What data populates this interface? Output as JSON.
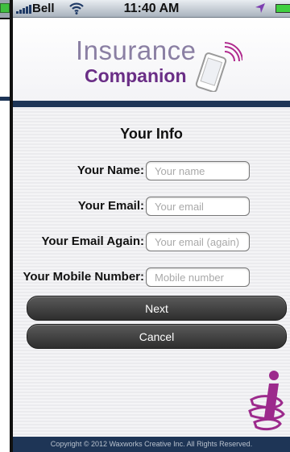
{
  "status_bar": {
    "carrier": "Bell",
    "time": "11:40 AM"
  },
  "app": {
    "logo_line1": "Insurance",
    "logo_line2": "Companion",
    "brand_colors": {
      "navy": "#1e3556",
      "purple": "#6a2e86",
      "accent": "#9c2a8c"
    }
  },
  "form": {
    "title": "Your Info",
    "fields": [
      {
        "label": "Your Name:",
        "placeholder": "Your name",
        "value": ""
      },
      {
        "label": "Your Email:",
        "placeholder": "Your email",
        "value": ""
      },
      {
        "label": "Your Email Again:",
        "placeholder": "Your email (again)",
        "value": ""
      },
      {
        "label": "Your Mobile Number:",
        "placeholder": "Mobile number",
        "value": ""
      }
    ],
    "next_label": "Next",
    "cancel_label": "Cancel"
  },
  "footer": {
    "copyright": "Copyright © 2012 Waxworks Creative Inc. All Rights Reserved."
  },
  "icons": [
    "signal-icon",
    "wifi-icon",
    "location-arrow-icon",
    "battery-icon",
    "phone-logo-icon",
    "brand-mark-icon"
  ]
}
